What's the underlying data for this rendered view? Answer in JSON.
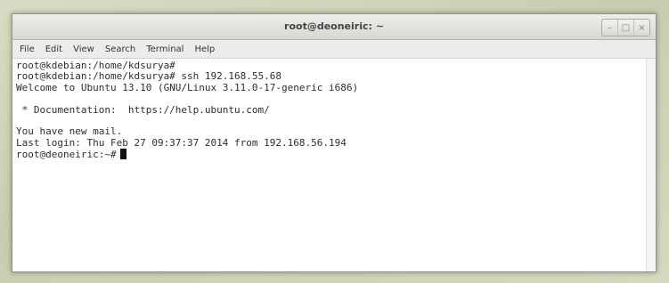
{
  "window": {
    "title": "root@deoneiric: ~",
    "controls": [
      "minimize",
      "maximize",
      "close"
    ]
  },
  "menu": {
    "items": [
      "File",
      "Edit",
      "View",
      "Search",
      "Terminal",
      "Help"
    ]
  },
  "terminal": {
    "lines": [
      "root@kdebian:/home/kdsurya#",
      "root@kdebian:/home/kdsurya# ssh 192.168.55.68",
      "Welcome to Ubuntu 13.10 (GNU/Linux 3.11.0-17-generic i686)",
      "",
      " * Documentation:  https://help.ubuntu.com/",
      "",
      "You have new mail.",
      "Last login: Thu Feb 27 09:37:37 2014 from 192.168.56.194"
    ],
    "prompt": "root@deoneiric:~#"
  },
  "icons": {
    "minimize": "minimize-icon",
    "maximize": "maximize-icon",
    "close": "close-icon"
  }
}
